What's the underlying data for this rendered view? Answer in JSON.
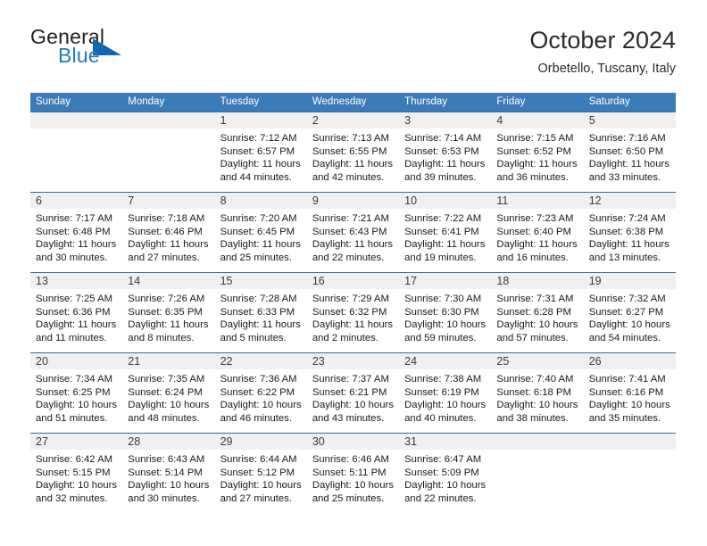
{
  "brand": {
    "name_part1": "General",
    "name_part2": "Blue",
    "flag_icon": "triangle-flag-icon",
    "accent_color": "#1f7ac4"
  },
  "header": {
    "title": "October 2024",
    "subtitle": "Orbetello, Tuscany, Italy"
  },
  "theme": {
    "header_blue": "#3b7cb8",
    "row_divider_blue": "#2f6da8",
    "day_band_gray": "#f0f0f0"
  },
  "weekday_headers": [
    "Sunday",
    "Monday",
    "Tuesday",
    "Wednesday",
    "Thursday",
    "Friday",
    "Saturday"
  ],
  "weeks": [
    {
      "days": [
        {
          "date": "",
          "empty": true,
          "sunrise": "",
          "sunset": "",
          "daylight_line1": "",
          "daylight_line2": ""
        },
        {
          "date": "",
          "empty": true,
          "sunrise": "",
          "sunset": "",
          "daylight_line1": "",
          "daylight_line2": ""
        },
        {
          "date": "1",
          "empty": false,
          "sunrise": "Sunrise: 7:12 AM",
          "sunset": "Sunset: 6:57 PM",
          "daylight_line1": "Daylight: 11 hours",
          "daylight_line2": "and 44 minutes."
        },
        {
          "date": "2",
          "empty": false,
          "sunrise": "Sunrise: 7:13 AM",
          "sunset": "Sunset: 6:55 PM",
          "daylight_line1": "Daylight: 11 hours",
          "daylight_line2": "and 42 minutes."
        },
        {
          "date": "3",
          "empty": false,
          "sunrise": "Sunrise: 7:14 AM",
          "sunset": "Sunset: 6:53 PM",
          "daylight_line1": "Daylight: 11 hours",
          "daylight_line2": "and 39 minutes."
        },
        {
          "date": "4",
          "empty": false,
          "sunrise": "Sunrise: 7:15 AM",
          "sunset": "Sunset: 6:52 PM",
          "daylight_line1": "Daylight: 11 hours",
          "daylight_line2": "and 36 minutes."
        },
        {
          "date": "5",
          "empty": false,
          "sunrise": "Sunrise: 7:16 AM",
          "sunset": "Sunset: 6:50 PM",
          "daylight_line1": "Daylight: 11 hours",
          "daylight_line2": "and 33 minutes."
        }
      ]
    },
    {
      "days": [
        {
          "date": "6",
          "empty": false,
          "sunrise": "Sunrise: 7:17 AM",
          "sunset": "Sunset: 6:48 PM",
          "daylight_line1": "Daylight: 11 hours",
          "daylight_line2": "and 30 minutes."
        },
        {
          "date": "7",
          "empty": false,
          "sunrise": "Sunrise: 7:18 AM",
          "sunset": "Sunset: 6:46 PM",
          "daylight_line1": "Daylight: 11 hours",
          "daylight_line2": "and 27 minutes."
        },
        {
          "date": "8",
          "empty": false,
          "sunrise": "Sunrise: 7:20 AM",
          "sunset": "Sunset: 6:45 PM",
          "daylight_line1": "Daylight: 11 hours",
          "daylight_line2": "and 25 minutes."
        },
        {
          "date": "9",
          "empty": false,
          "sunrise": "Sunrise: 7:21 AM",
          "sunset": "Sunset: 6:43 PM",
          "daylight_line1": "Daylight: 11 hours",
          "daylight_line2": "and 22 minutes."
        },
        {
          "date": "10",
          "empty": false,
          "sunrise": "Sunrise: 7:22 AM",
          "sunset": "Sunset: 6:41 PM",
          "daylight_line1": "Daylight: 11 hours",
          "daylight_line2": "and 19 minutes."
        },
        {
          "date": "11",
          "empty": false,
          "sunrise": "Sunrise: 7:23 AM",
          "sunset": "Sunset: 6:40 PM",
          "daylight_line1": "Daylight: 11 hours",
          "daylight_line2": "and 16 minutes."
        },
        {
          "date": "12",
          "empty": false,
          "sunrise": "Sunrise: 7:24 AM",
          "sunset": "Sunset: 6:38 PM",
          "daylight_line1": "Daylight: 11 hours",
          "daylight_line2": "and 13 minutes."
        }
      ]
    },
    {
      "days": [
        {
          "date": "13",
          "empty": false,
          "sunrise": "Sunrise: 7:25 AM",
          "sunset": "Sunset: 6:36 PM",
          "daylight_line1": "Daylight: 11 hours",
          "daylight_line2": "and 11 minutes."
        },
        {
          "date": "14",
          "empty": false,
          "sunrise": "Sunrise: 7:26 AM",
          "sunset": "Sunset: 6:35 PM",
          "daylight_line1": "Daylight: 11 hours",
          "daylight_line2": "and 8 minutes."
        },
        {
          "date": "15",
          "empty": false,
          "sunrise": "Sunrise: 7:28 AM",
          "sunset": "Sunset: 6:33 PM",
          "daylight_line1": "Daylight: 11 hours",
          "daylight_line2": "and 5 minutes."
        },
        {
          "date": "16",
          "empty": false,
          "sunrise": "Sunrise: 7:29 AM",
          "sunset": "Sunset: 6:32 PM",
          "daylight_line1": "Daylight: 11 hours",
          "daylight_line2": "and 2 minutes."
        },
        {
          "date": "17",
          "empty": false,
          "sunrise": "Sunrise: 7:30 AM",
          "sunset": "Sunset: 6:30 PM",
          "daylight_line1": "Daylight: 10 hours",
          "daylight_line2": "and 59 minutes."
        },
        {
          "date": "18",
          "empty": false,
          "sunrise": "Sunrise: 7:31 AM",
          "sunset": "Sunset: 6:28 PM",
          "daylight_line1": "Daylight: 10 hours",
          "daylight_line2": "and 57 minutes."
        },
        {
          "date": "19",
          "empty": false,
          "sunrise": "Sunrise: 7:32 AM",
          "sunset": "Sunset: 6:27 PM",
          "daylight_line1": "Daylight: 10 hours",
          "daylight_line2": "and 54 minutes."
        }
      ]
    },
    {
      "days": [
        {
          "date": "20",
          "empty": false,
          "sunrise": "Sunrise: 7:34 AM",
          "sunset": "Sunset: 6:25 PM",
          "daylight_line1": "Daylight: 10 hours",
          "daylight_line2": "and 51 minutes."
        },
        {
          "date": "21",
          "empty": false,
          "sunrise": "Sunrise: 7:35 AM",
          "sunset": "Sunset: 6:24 PM",
          "daylight_line1": "Daylight: 10 hours",
          "daylight_line2": "and 48 minutes."
        },
        {
          "date": "22",
          "empty": false,
          "sunrise": "Sunrise: 7:36 AM",
          "sunset": "Sunset: 6:22 PM",
          "daylight_line1": "Daylight: 10 hours",
          "daylight_line2": "and 46 minutes."
        },
        {
          "date": "23",
          "empty": false,
          "sunrise": "Sunrise: 7:37 AM",
          "sunset": "Sunset: 6:21 PM",
          "daylight_line1": "Daylight: 10 hours",
          "daylight_line2": "and 43 minutes."
        },
        {
          "date": "24",
          "empty": false,
          "sunrise": "Sunrise: 7:38 AM",
          "sunset": "Sunset: 6:19 PM",
          "daylight_line1": "Daylight: 10 hours",
          "daylight_line2": "and 40 minutes."
        },
        {
          "date": "25",
          "empty": false,
          "sunrise": "Sunrise: 7:40 AM",
          "sunset": "Sunset: 6:18 PM",
          "daylight_line1": "Daylight: 10 hours",
          "daylight_line2": "and 38 minutes."
        },
        {
          "date": "26",
          "empty": false,
          "sunrise": "Sunrise: 7:41 AM",
          "sunset": "Sunset: 6:16 PM",
          "daylight_line1": "Daylight: 10 hours",
          "daylight_line2": "and 35 minutes."
        }
      ]
    },
    {
      "days": [
        {
          "date": "27",
          "empty": false,
          "sunrise": "Sunrise: 6:42 AM",
          "sunset": "Sunset: 5:15 PM",
          "daylight_line1": "Daylight: 10 hours",
          "daylight_line2": "and 32 minutes."
        },
        {
          "date": "28",
          "empty": false,
          "sunrise": "Sunrise: 6:43 AM",
          "sunset": "Sunset: 5:14 PM",
          "daylight_line1": "Daylight: 10 hours",
          "daylight_line2": "and 30 minutes."
        },
        {
          "date": "29",
          "empty": false,
          "sunrise": "Sunrise: 6:44 AM",
          "sunset": "Sunset: 5:12 PM",
          "daylight_line1": "Daylight: 10 hours",
          "daylight_line2": "and 27 minutes."
        },
        {
          "date": "30",
          "empty": false,
          "sunrise": "Sunrise: 6:46 AM",
          "sunset": "Sunset: 5:11 PM",
          "daylight_line1": "Daylight: 10 hours",
          "daylight_line2": "and 25 minutes."
        },
        {
          "date": "31",
          "empty": false,
          "sunrise": "Sunrise: 6:47 AM",
          "sunset": "Sunset: 5:09 PM",
          "daylight_line1": "Daylight: 10 hours",
          "daylight_line2": "and 22 minutes."
        },
        {
          "date": "",
          "empty": true,
          "sunrise": "",
          "sunset": "",
          "daylight_line1": "",
          "daylight_line2": ""
        },
        {
          "date": "",
          "empty": true,
          "sunrise": "",
          "sunset": "",
          "daylight_line1": "",
          "daylight_line2": ""
        }
      ]
    }
  ]
}
